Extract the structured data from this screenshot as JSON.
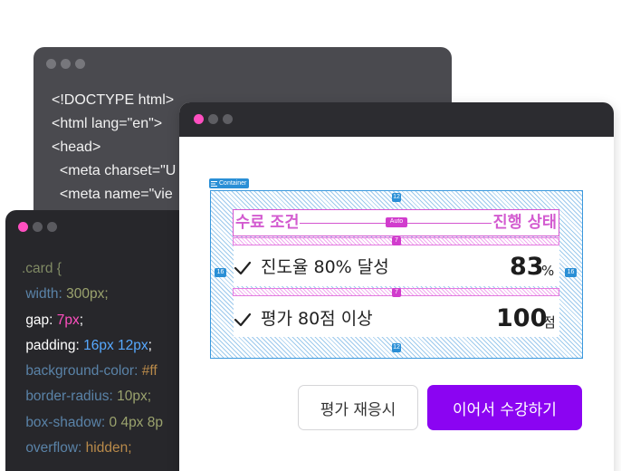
{
  "html_window": {
    "code_lines": [
      "<!DOCTYPE html>",
      "<html lang=\"en\">",
      "<head>",
      "  <meta charset=\"U",
      "  <meta name=\"vie"
    ]
  },
  "css_window": {
    "selector": ".card {",
    "props": {
      "width_name": "width:",
      "width_value": "300px;",
      "gap_name": "gap:",
      "gap_value": "7px",
      "padding_name": "padding:",
      "padding_value": "16px 12px",
      "bg_name": "background-color:",
      "bg_value": "#ff",
      "radius_name": "border-radius:",
      "radius_value": "10px;",
      "shadow_name": "box-shadow:",
      "shadow_value": "0 4px 8p",
      "overflow_name": "overflow:",
      "overflow_value": "hidden;"
    },
    "semicolon": ";"
  },
  "main_window": {
    "container_badge": "Container",
    "header": {
      "left_label": "수료 조건",
      "right_label": "진행 상태",
      "auto_tag": "Auto"
    },
    "spacing": {
      "top": "12",
      "bottom": "12",
      "left": "16",
      "right": "16",
      "gap": "7"
    },
    "items": [
      {
        "label": "진도율 80% 달성",
        "value": "83",
        "unit": "%"
      },
      {
        "label": "평가 80점 이상",
        "value": "100",
        "unit": "점"
      }
    ],
    "buttons": {
      "retake": "평가 재응시",
      "continue": "이어서 수강하기"
    }
  },
  "colors": {
    "accent_purple": "#8b04f2",
    "magenta": "#ff4fc0",
    "blue": "#2a8fd6",
    "dot_gray": "#77777c"
  }
}
